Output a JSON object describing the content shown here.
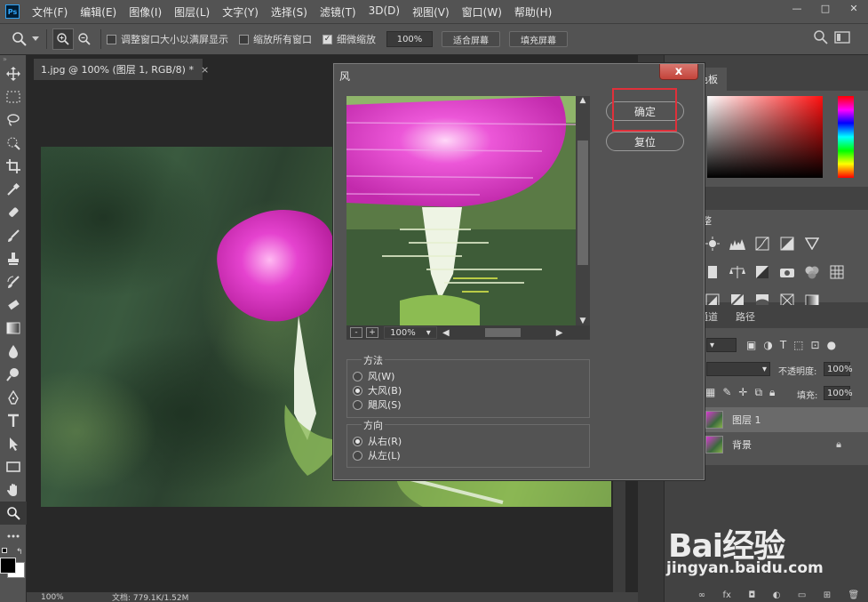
{
  "app": {
    "logo": "Ps"
  },
  "menu": [
    "文件(F)",
    "编辑(E)",
    "图像(I)",
    "图层(L)",
    "文字(Y)",
    "选择(S)",
    "滤镜(T)",
    "3D(D)",
    "视图(V)",
    "窗口(W)",
    "帮助(H)"
  ],
  "window_controls": {
    "minimize": "—",
    "maximize": "□",
    "close": "✕"
  },
  "options": {
    "resize_window": "调整窗口大小以满屏显示",
    "zoom_all": "缩放所有窗口",
    "scrubby_zoom": "细微缩放",
    "zoom_value": "100%",
    "fit_screen": "适合屏幕",
    "fill_screen": "填充屏幕"
  },
  "document": {
    "tab": "1.jpg @ 100% (图层 1, RGB/8) *",
    "close": "×"
  },
  "status": {
    "zoom": "100%",
    "doc": "文档: 779.1K/1.52M"
  },
  "panels": {
    "color_tab": "色板",
    "adjust_tab": "整",
    "layers_tabs": [
      "通道",
      "路径"
    ],
    "opacity_label": "不透明度:",
    "opacity_value": "100%",
    "fill_label": "填充:",
    "fill_value": "100%",
    "layers": [
      {
        "name": "图层 1"
      },
      {
        "name": "背景"
      }
    ]
  },
  "dialog": {
    "title": "风",
    "close": "x",
    "ok": "确定",
    "reset": "复位",
    "zoom": "100%",
    "minus": "-",
    "plus": "+",
    "method_title": "方法",
    "methods": [
      "风(W)",
      "大风(B)",
      "飓风(S)"
    ],
    "method_selected": 1,
    "direction_title": "方向",
    "directions": [
      "从右(R)",
      "从左(L)"
    ],
    "direction_selected": 0
  },
  "watermark": {
    "brand": "Bai经验",
    "url": "jingyan.baidu.com"
  },
  "colors": {
    "highlight": "#e0303a",
    "accent_magenta": "#e03bc8"
  }
}
